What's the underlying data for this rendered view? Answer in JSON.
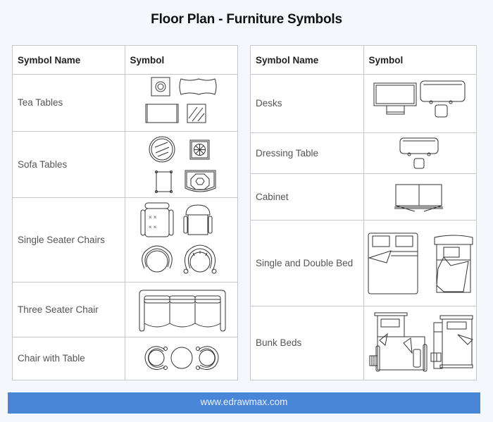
{
  "title": "Floor Plan - Furniture Symbols",
  "tables": [
    {
      "header": {
        "name": "Symbol Name",
        "symbol": "Symbol"
      },
      "rows": [
        {
          "name": "Tea Tables",
          "icons": [
            "round-tea-table-icon",
            "oval-tea-table-icon",
            "rectangular-tea-table-icon",
            "glass-tea-table-icon"
          ]
        },
        {
          "name": "Sofa Tables",
          "icons": [
            "round-glass-table-icon",
            "octagon-table-icon",
            "square-table-icon",
            "curved-octagon-table-icon"
          ]
        },
        {
          "name": "Single Seater Chairs",
          "icons": [
            "tufted-armchair-icon",
            "armchair-icon",
            "round-chair-icon",
            "scroll-arm-chair-icon"
          ]
        },
        {
          "name": "Three Seater Chair",
          "icons": [
            "three-seater-sofa-icon"
          ]
        },
        {
          "name": "Chair with Table",
          "icons": [
            "left-chair-icon",
            "round-table-icon",
            "right-chair-icon"
          ]
        }
      ]
    },
    {
      "header": {
        "name": "Symbol Name",
        "symbol": "Symbol"
      },
      "rows": [
        {
          "name": "Desks",
          "icons": [
            "desk-with-monitor-icon",
            "desk-with-stool-icon"
          ]
        },
        {
          "name": "Dressing Table",
          "icons": [
            "dressing-table-icon"
          ]
        },
        {
          "name": "Cabinet",
          "icons": [
            "cabinet-icon"
          ]
        },
        {
          "name": "Single and Double Bed",
          "icons": [
            "double-bed-icon",
            "single-bed-icon"
          ]
        },
        {
          "name": "Bunk Beds",
          "icons": [
            "l-shaped-bunk-bed-icon",
            "bunk-bed-icon"
          ]
        }
      ]
    }
  ],
  "footer": {
    "url": "www.edrawmax.com",
    "color": "#4a86d8"
  }
}
